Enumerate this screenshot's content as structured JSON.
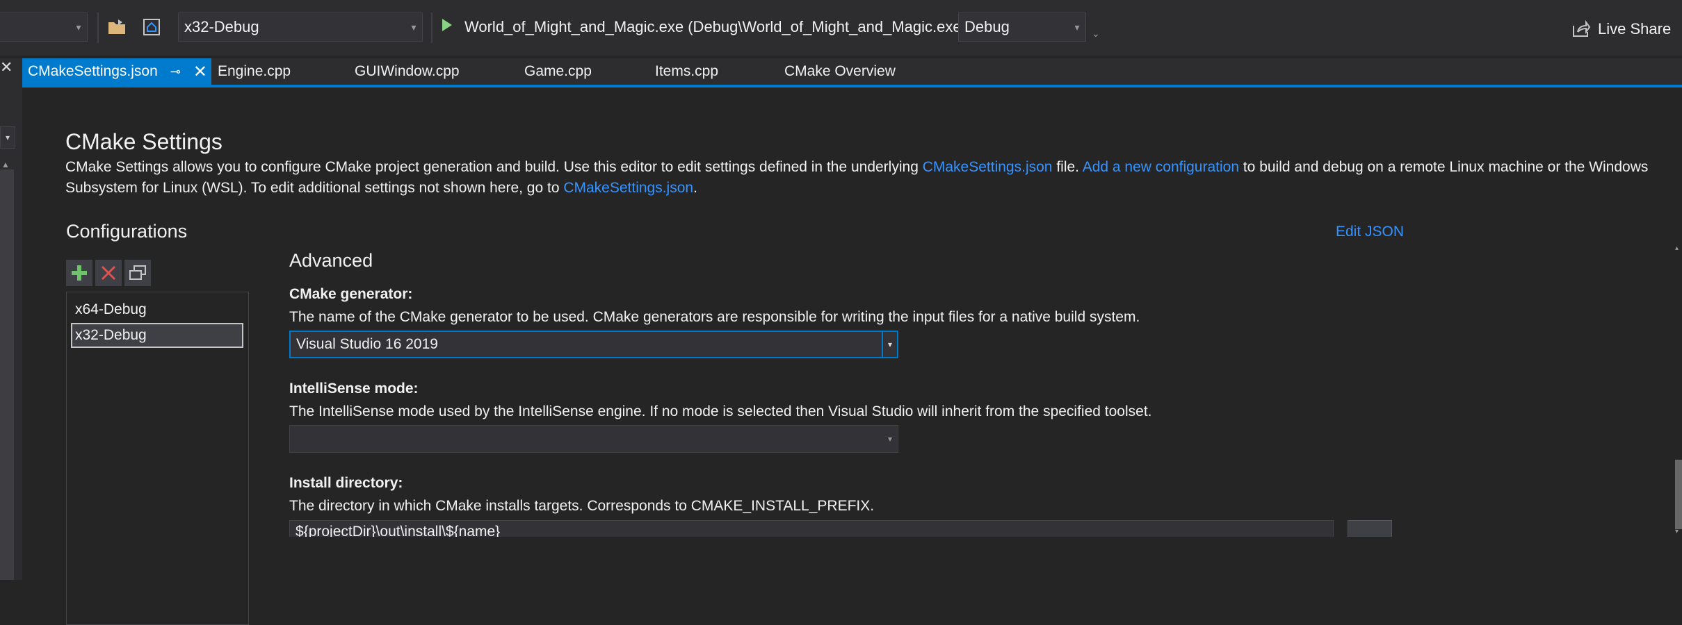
{
  "toolbar": {
    "config_value": "x32-Debug",
    "run_target": "World_of_Might_and_Magic.exe (Debug\\World_of_Might_and_Magic.exe)",
    "mode_value": "Debug",
    "live_share_label": "Live Share"
  },
  "tabs": [
    {
      "label": "CMakeSettings.json",
      "active": true
    },
    {
      "label": "Engine.cpp"
    },
    {
      "label": "GUIWindow.cpp"
    },
    {
      "label": "Game.cpp"
    },
    {
      "label": "Items.cpp"
    },
    {
      "label": "CMake Overview"
    }
  ],
  "page": {
    "title": "CMake Settings",
    "intro_1": "CMake Settings allows you to configure CMake project generation and build. Use this editor to edit settings defined in the underlying ",
    "intro_link_1": "CMakeSettings.json",
    "intro_2": " file. ",
    "intro_link_2": "Add a new configuration",
    "intro_3": " to build and debug on a remote Linux machine or the Windows",
    "intro_4": "Subsystem for Linux (WSL). To edit additional settings not shown here, go to ",
    "intro_link_3": "CMakeSettings.json",
    "intro_5": ".",
    "edit_json_label": "Edit JSON"
  },
  "configurations": {
    "heading": "Configurations",
    "items": [
      "x64-Debug",
      "x32-Debug"
    ],
    "selected": "x32-Debug"
  },
  "advanced": {
    "heading": "Advanced",
    "generator": {
      "label": "CMake generator:",
      "description": "The name of the CMake generator to be used. CMake generators are responsible for writing the input files for a native build system.",
      "value": "Visual Studio 16 2019"
    },
    "intellisense": {
      "label": "IntelliSense mode:",
      "description": "The IntelliSense mode used by the IntelliSense engine. If no mode is selected then Visual Studio will inherit from the specified toolset.",
      "value": ""
    },
    "install_dir": {
      "label": "Install directory:",
      "description": "The directory in which CMake installs targets. Corresponds to CMAKE_INSTALL_PREFIX.",
      "value": "${projectDir}\\out\\install\\${name}"
    }
  },
  "colors": {
    "accent": "#007acc",
    "link": "#3794ff",
    "background": "#252526",
    "play_green": "#89d185"
  }
}
